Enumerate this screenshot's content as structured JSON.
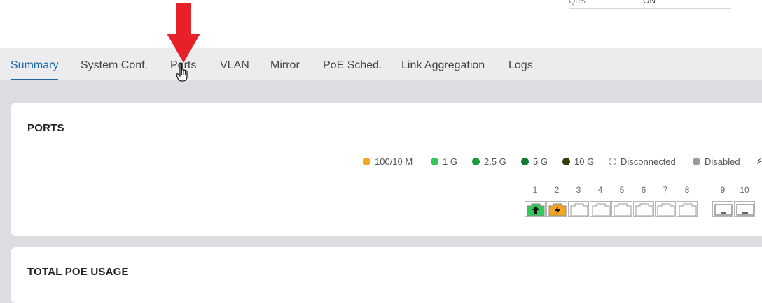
{
  "header": {
    "qos_label": "QoS",
    "qos_value": "ON"
  },
  "tabs": [
    {
      "label": "Summary",
      "active": true
    },
    {
      "label": "System Conf."
    },
    {
      "label": "Ports"
    },
    {
      "label": "VLAN"
    },
    {
      "label": "Mirror"
    },
    {
      "label": "PoE Sched."
    },
    {
      "label": "Link Aggregation"
    },
    {
      "label": "Logs"
    }
  ],
  "ports_card": {
    "title": "PORTS",
    "legend": [
      {
        "label": "100/10 M",
        "color": "#f5a524"
      },
      {
        "label": "1 G",
        "color": "#34c759"
      },
      {
        "label": "2.5 G",
        "color": "#1a9b3c"
      },
      {
        "label": "5 G",
        "color": "#157a32"
      },
      {
        "label": "10 G",
        "color": "#2d3e0b"
      },
      {
        "label": "Disconnected",
        "color": "#ffffff"
      },
      {
        "label": "Disabled",
        "color": "#9a9a9a"
      }
    ],
    "ports": [
      {
        "number": "1",
        "status": "1g-uplink",
        "color": "#34c759"
      },
      {
        "number": "2",
        "status": "100m-poe",
        "color": "#f5a524"
      },
      {
        "number": "3",
        "status": "disconnected"
      },
      {
        "number": "4",
        "status": "disconnected"
      },
      {
        "number": "5",
        "status": "disconnected"
      },
      {
        "number": "6",
        "status": "disconnected"
      },
      {
        "number": "7",
        "status": "disconnected"
      },
      {
        "number": "8",
        "status": "disconnected"
      },
      {
        "number": "9",
        "status": "sfp-disconnected"
      },
      {
        "number": "10",
        "status": "sfp-disconnected"
      }
    ]
  },
  "poe_card": {
    "title": "TOTAL POE USAGE"
  },
  "colors": {
    "accent": "#1b6aa6",
    "annotation_arrow": "#e8202a"
  }
}
